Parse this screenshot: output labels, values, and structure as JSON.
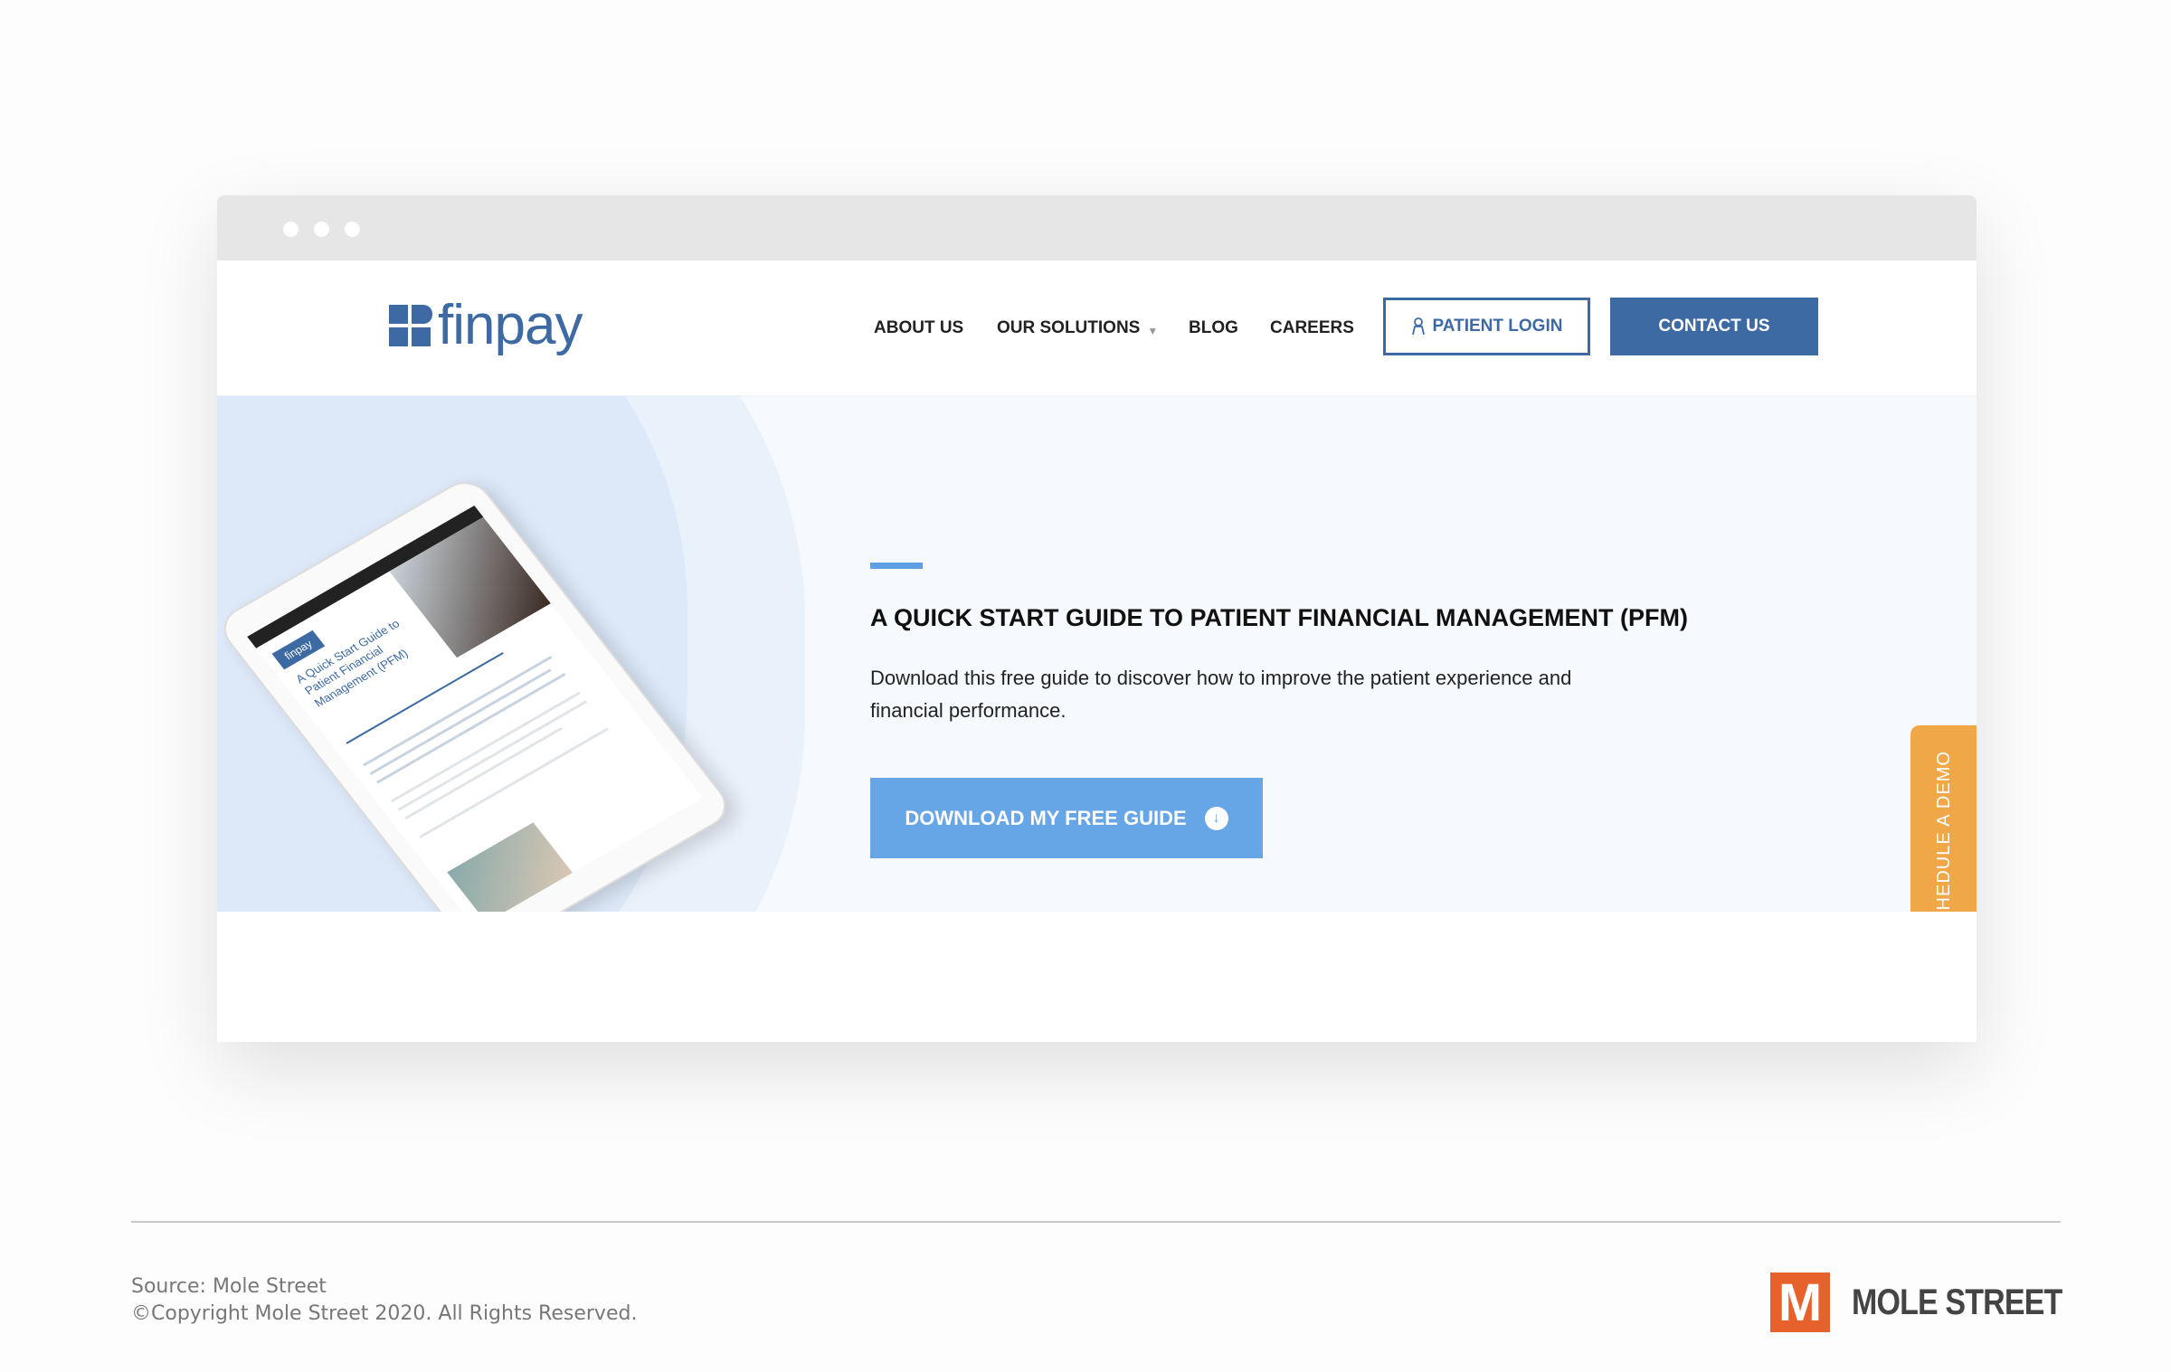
{
  "browser": {
    "dots": 3
  },
  "header": {
    "logo": "finpay",
    "nav": [
      "ABOUT US",
      "OUR SOLUTIONS",
      "BLOG",
      "CAREERS"
    ],
    "patient_login": "PATIENT LOGIN",
    "contact": "CONTACT US"
  },
  "hero": {
    "tablet": {
      "badge": "finpay",
      "title": "A Quick Start Guide to Patient Financial Management (PFM)"
    },
    "title": "A QUICK START GUIDE TO PATIENT FINANCIAL MANAGEMENT (PFM)",
    "description": "Download this free guide to discover how to improve the patient experience and financial performance.",
    "button": "DOWNLOAD MY FREE GUIDE",
    "schedule_demo": "SCHEDULE A DEMO"
  },
  "footer": {
    "source": "Source: Mole Street",
    "copyright": "©Copyright Mole Street 2020. All Rights Reserved.",
    "brand": "MOLE STREET",
    "brand_mark": "M"
  },
  "colors": {
    "brand": "#3d6aa3",
    "accent": "#66a5e6",
    "demo": "#f0a748",
    "mole_street": "#e6622a"
  }
}
